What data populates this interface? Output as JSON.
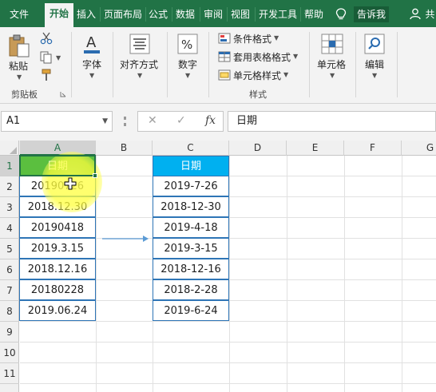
{
  "ribbon_tabs": {
    "file": "文件",
    "home": "开始",
    "insert": "插入",
    "page_layout": "页面布局",
    "formulas": "公式",
    "data": "数据",
    "review": "审阅",
    "view": "视图",
    "developer": "开发工具",
    "help": "帮助",
    "tell_me": "告诉我",
    "share": "共"
  },
  "ribbon": {
    "clipboard": {
      "paste": "粘贴",
      "group_label": "剪贴板"
    },
    "font": {
      "label": "字体"
    },
    "alignment": {
      "label": "对齐方式"
    },
    "number": {
      "label": "数字"
    },
    "styles": {
      "conditional_formatting": "条件格式",
      "format_as_table": "套用表格格式",
      "cell_styles": "单元格样式",
      "group_label": "样式"
    },
    "cells": {
      "label": "单元格"
    },
    "editing": {
      "label": "编辑"
    }
  },
  "formula_bar": {
    "name_box": "A1",
    "fx": "fx",
    "cancel": "✕",
    "enter": "✓",
    "content": "日期"
  },
  "sheet": {
    "columns": [
      "A",
      "B",
      "C",
      "D",
      "E",
      "F",
      "G"
    ],
    "rows": [
      "1",
      "2",
      "3",
      "4",
      "5",
      "6",
      "7",
      "8",
      "9",
      "10",
      "11"
    ],
    "source_column": {
      "header": "日期",
      "values": [
        "20190726",
        "2018.12.30",
        "20190418",
        "2019.3.15",
        "2018.12.16",
        "20180228",
        "2019.06.24"
      ]
    },
    "result_column": {
      "header": "日期",
      "values": [
        "2019-7-26",
        "2018-12-30",
        "2019-4-18",
        "2019-3-15",
        "2018-12-16",
        "2018-2-28",
        "2019-6-24"
      ]
    }
  },
  "colors": {
    "ribbon_green": "#217346",
    "header_fill": "#00b0f0",
    "table_border": "#2e75b6",
    "selection_green": "#5bbf3f"
  }
}
